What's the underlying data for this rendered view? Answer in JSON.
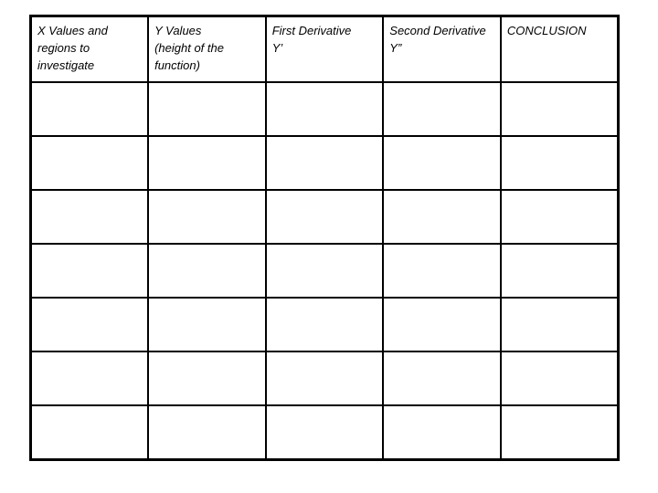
{
  "document": {
    "type": "worksheet-table",
    "background_color": "#ffffff",
    "border_color": "#000000",
    "text_color": "#000000"
  },
  "table": {
    "column_count": 5,
    "body_row_count": 7,
    "columns": [
      {
        "id": "x-values",
        "header": "X Values and regions to investigate"
      },
      {
        "id": "y-values",
        "header": "Y Values\n(height of the function)"
      },
      {
        "id": "first-derivative",
        "header": "First Derivative\nY’"
      },
      {
        "id": "second-derivative",
        "header": "Second Derivative\nY”"
      },
      {
        "id": "conclusion",
        "header": "CONCLUSION"
      }
    ],
    "rows": [
      {
        "cells": [
          "",
          "",
          "",
          "",
          ""
        ]
      },
      {
        "cells": [
          "",
          "",
          "",
          "",
          ""
        ]
      },
      {
        "cells": [
          "",
          "",
          "",
          "",
          ""
        ]
      },
      {
        "cells": [
          "",
          "",
          "",
          "",
          ""
        ]
      },
      {
        "cells": [
          "",
          "",
          "",
          "",
          ""
        ]
      },
      {
        "cells": [
          "",
          "",
          "",
          "",
          ""
        ]
      },
      {
        "cells": [
          "",
          "",
          "",
          "",
          ""
        ]
      }
    ]
  }
}
